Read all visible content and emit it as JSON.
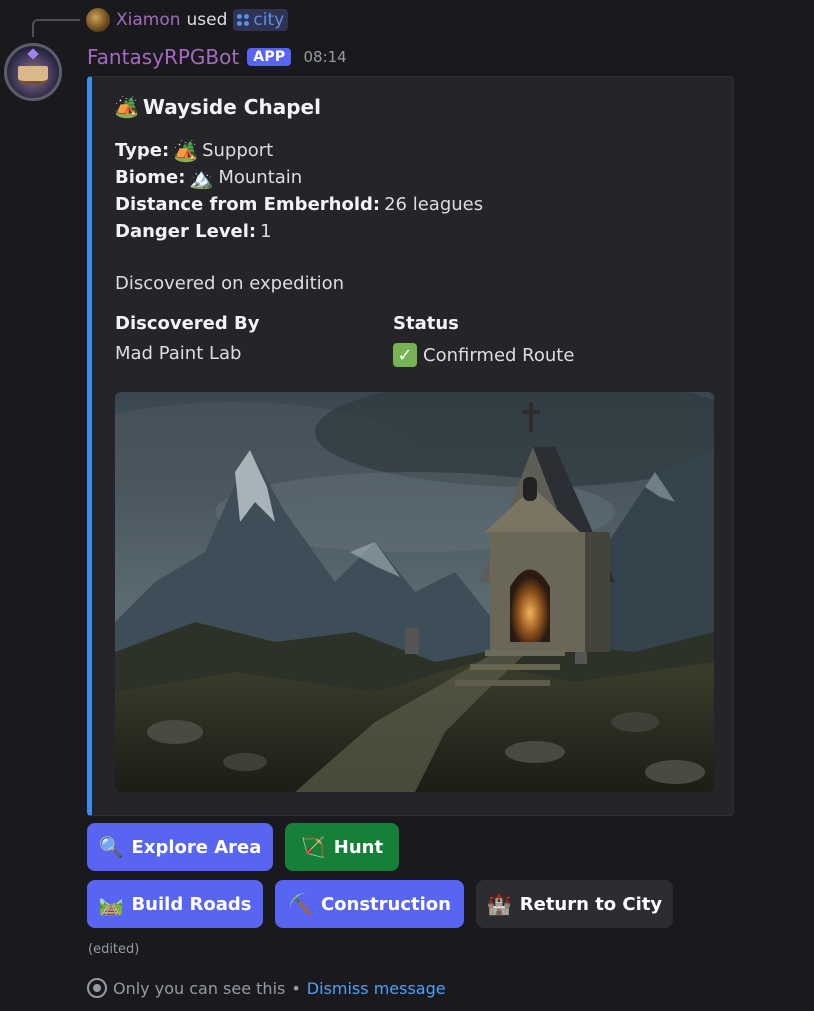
{
  "reply": {
    "user": "Xiamon",
    "used_text": "used",
    "command": "city",
    "command_icon": "apps-icon"
  },
  "message": {
    "bot_name": "FantasyRPGBot",
    "badge": "APP",
    "timestamp": "08:14",
    "name_color": "#a46ac0"
  },
  "embed": {
    "accent_color": "#3a8ef0",
    "title_emoji": "🏕️",
    "title": "Wayside Chapel",
    "fields": [
      {
        "label": "Type:",
        "emoji": "🏕️",
        "value": "Support"
      },
      {
        "label": "Biome:",
        "emoji": "🏔️",
        "value": "Mountain"
      },
      {
        "label": "Distance from Emberhold:",
        "emoji": "",
        "value": "26 leagues"
      },
      {
        "label": "Danger Level:",
        "emoji": "",
        "value": "1"
      }
    ],
    "description": "Discovered on expedition",
    "inline_fields": [
      {
        "name": "Discovered By",
        "value": "Mad Paint Lab"
      },
      {
        "name": "Status",
        "value": "Confirmed Route",
        "icon": "check-mark-icon"
      }
    ],
    "image_subject": "stone chapel on a rocky mountain slope"
  },
  "buttons": [
    {
      "emoji": "🔍",
      "label": "Explore Area",
      "style": "primary",
      "color": "#5865f2"
    },
    {
      "emoji": "🏹",
      "label": "Hunt",
      "style": "success",
      "color": "#178038"
    },
    {
      "emoji": "🛤️",
      "label": "Build Roads",
      "style": "primary",
      "color": "#5865f2"
    },
    {
      "emoji": "⛏️",
      "label": "Construction",
      "style": "primary",
      "color": "#5865f2"
    },
    {
      "emoji": "🏰",
      "label": "Return to City",
      "style": "secondary",
      "color": "#2b2d31"
    }
  ],
  "footer": {
    "edited": "(edited)",
    "ephemeral_text": "Only you can see this",
    "separator": "•",
    "dismiss": "Dismiss message"
  }
}
